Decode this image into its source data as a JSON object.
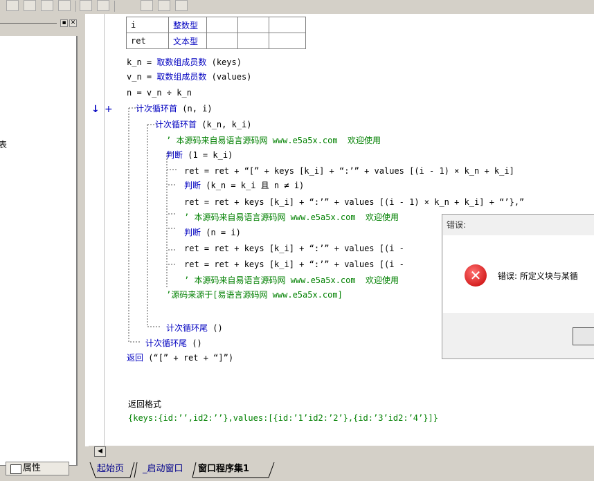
{
  "toolbar": {
    "icons": [
      "insert-row-icon",
      "insert-col-icon",
      "delete-row-icon",
      "delete-col-icon",
      "merge-h-icon",
      "merge-v-icon",
      "width-icon",
      "height-icon",
      "fit-icon"
    ]
  },
  "left_panel": {
    "truncated_label": "表",
    "window_buttons": [
      "▪",
      "✕"
    ],
    "properties_button": "属性"
  },
  "var_table": {
    "rows": [
      {
        "name": "i",
        "type": "整数型"
      },
      {
        "name": "ret",
        "type": "文本型"
      }
    ]
  },
  "code_lines": [
    {
      "t": "k_n = ",
      "f": "取数组成员数",
      "a": " (keys)"
    },
    {
      "t": "v_n = ",
      "f": "取数组成员数",
      "a": " (values)"
    },
    {
      "t": "n = v_n ÷ k_n"
    },
    {
      "loop": "计次循环首",
      "a": " (n, i)"
    },
    {
      "loop": "计次循环首",
      "a": " (k_n, k_i)"
    },
    {
      "comment": "’ 本源码来自易语言源码网 www.e5a5x.com  欢迎使用"
    },
    {
      "kw": "判断",
      "a": " (1 = k_i)"
    },
    {
      "t": "ret = ret + “[” + keys [k_i] + “:’” + values [(i - 1) × k_n + k_i]"
    },
    {
      "kw": "判断",
      "a": " (k_n = k_i 且 n ≠ i)"
    },
    {
      "t": "ret = ret + keys [k_i] + “:’” + values [(i - 1) × k_n + k_i] + “’},”"
    },
    {
      "comment": "’ 本源码来自易语言源码网 www.e5a5x.com  欢迎使用"
    },
    {
      "kw": "判断",
      "a": " (n = i)"
    },
    {
      "t": "ret = ret + keys [k_i] + “:’” + values [(i -"
    },
    {
      "t": "ret = ret + keys [k_i] + “:’” + values [(i -"
    },
    {
      "comment": "’ 本源码来自易语言源码网 www.e5a5x.com  欢迎使用"
    },
    {
      "comment": "’源码来源于[易语言源码网 www.e5a5x.com]"
    },
    {
      "loop": "计次循环尾",
      "a": " ()"
    },
    {
      "loop": "计次循环尾",
      "a": " ()"
    },
    {
      "ret": "返回",
      "a": " (“[” + ret + “]”)"
    },
    {
      "heading": "返回格式"
    },
    {
      "fmt": "{keys:{id:’’,id2:’’},values:[{id:’1’id2:’2’},{id:’3’id2:’4’}]}"
    }
  ],
  "gutter": {
    "arrow": "↓",
    "plus": "+"
  },
  "dialog": {
    "title": "错误:",
    "message": "错误: 所定义块与某循",
    "icon": "error-icon"
  },
  "tabs": [
    {
      "label": "起始页"
    },
    {
      "label": "_启动窗口"
    },
    {
      "label": "窗口程序集1"
    }
  ],
  "colors": {
    "keyword": "#0000c0",
    "comment": "#008000",
    "background": "#d4d0c8"
  }
}
